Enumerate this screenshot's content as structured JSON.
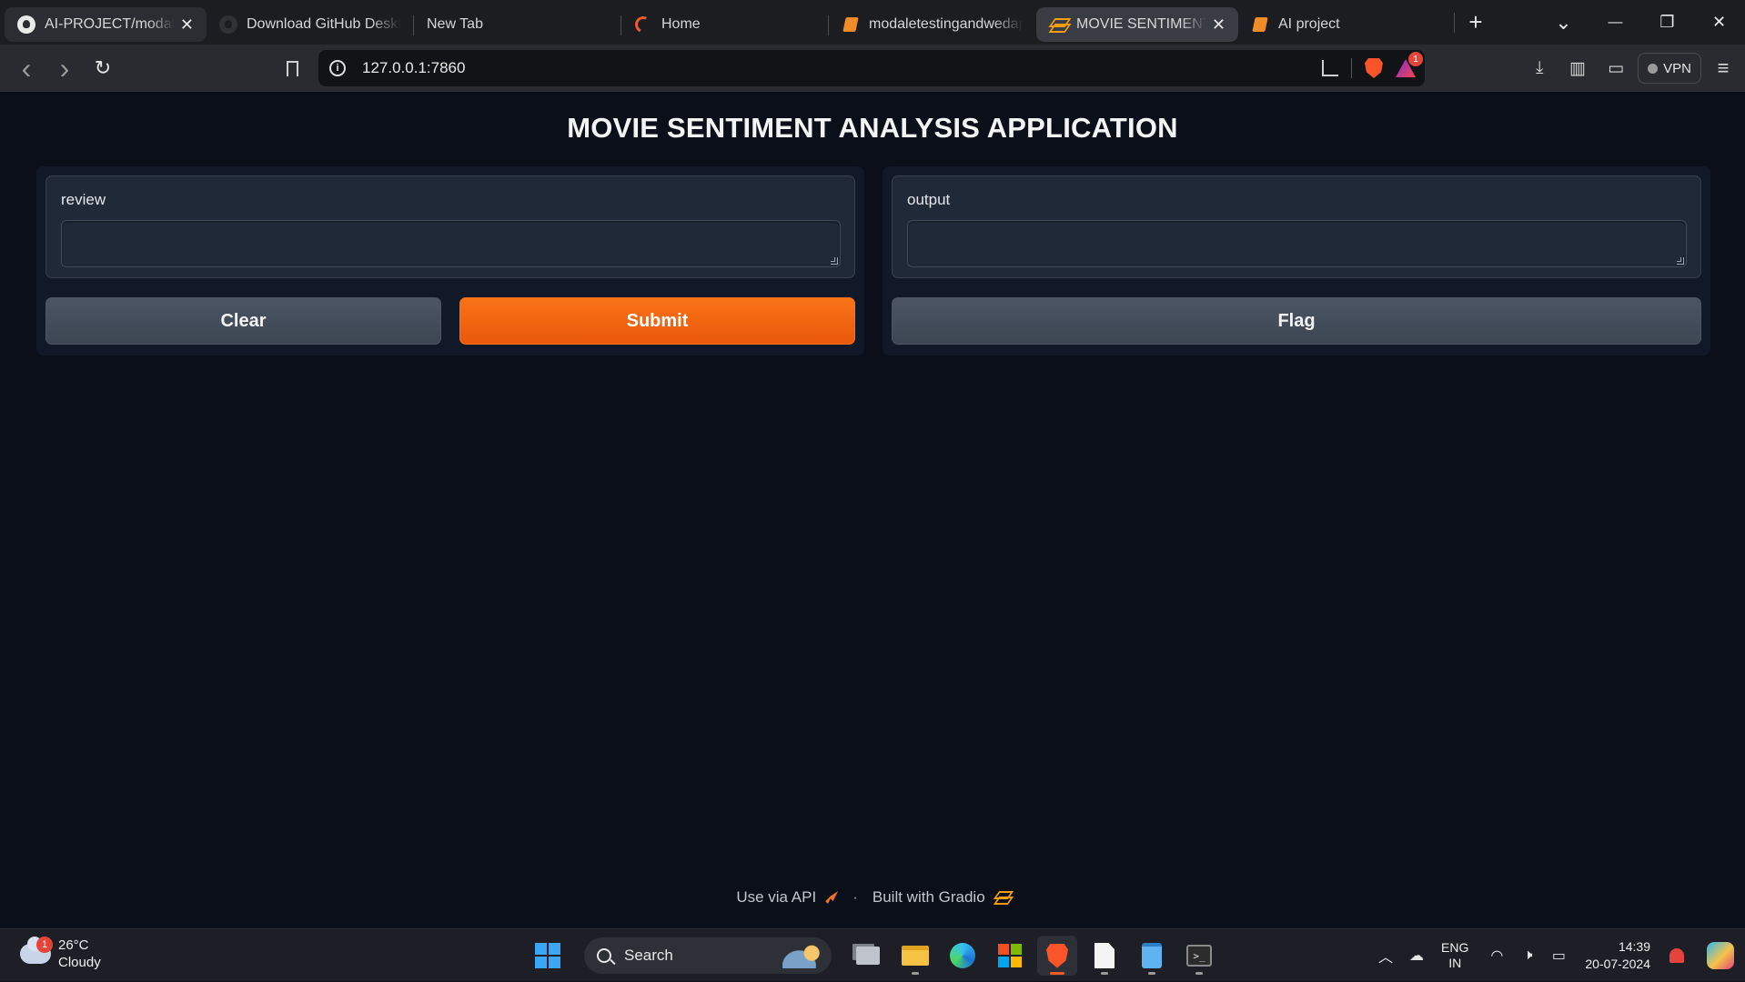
{
  "browser": {
    "tabs": [
      {
        "title": "AI-PROJECT/modaletestingandwedapp",
        "icon": "github-icon",
        "close": "✕"
      },
      {
        "title": "Download GitHub Desktop",
        "icon": "github-icon"
      },
      {
        "title": "New Tab",
        "icon": ""
      },
      {
        "title": "Home",
        "icon": "home-icon"
      },
      {
        "title": "modaletestingandwedapp",
        "icon": "book-icon"
      },
      {
        "title": "MOVIE SENTIMENT ANALYSIS APPLICATION",
        "icon": "gradio-icon",
        "close": "✕"
      },
      {
        "title": "AI project",
        "icon": "book-icon"
      }
    ],
    "new_tab": "+",
    "window_controls": {
      "tab_list": "⌄",
      "minimize": "—",
      "restore": "❐",
      "close": "✕"
    },
    "nav": {
      "back": "‹",
      "forward": "›",
      "reload": "↻"
    },
    "url": "127.0.0.1:7860",
    "rewards_badge": "1",
    "vpn_label": "VPN",
    "toolbar_icons": {
      "download": "⤓",
      "sidebar": "▥",
      "wallet": "▭",
      "menu": "≡"
    }
  },
  "app": {
    "title": "MOVIE SENTIMENT ANALYSIS APPLICATION",
    "input": {
      "label": "review",
      "value": ""
    },
    "output": {
      "label": "output",
      "value": ""
    },
    "buttons": {
      "clear": "Clear",
      "submit": "Submit",
      "flag": "Flag"
    },
    "footer": {
      "api": "Use via API",
      "separator": "·",
      "built": "Built with Gradio"
    },
    "colors": {
      "primary": "#f97316",
      "secondary": "#4b5563",
      "background": "#0b0f19"
    }
  },
  "taskbar": {
    "weather": {
      "temp": "26°C",
      "condition": "Cloudy",
      "badge": "1"
    },
    "search_label": "Search",
    "language": {
      "line1": "ENG",
      "line2": "IN"
    },
    "clock": {
      "time": "14:39",
      "date": "20-07-2024"
    },
    "terminal_glyph": ">_"
  }
}
